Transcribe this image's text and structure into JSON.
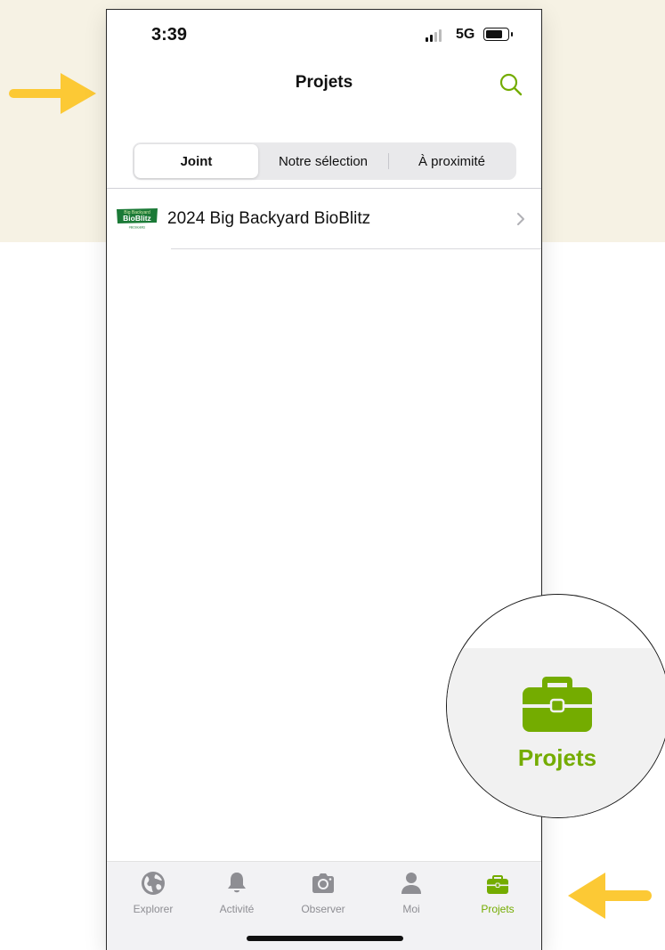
{
  "status_bar": {
    "time": "3:39",
    "network": "5G"
  },
  "header": {
    "title": "Projets",
    "search_icon": "search-icon"
  },
  "segments": [
    {
      "label": "Joint",
      "selected": true
    },
    {
      "label": "Notre sélection",
      "selected": false
    },
    {
      "label": "À proximité",
      "selected": false
    }
  ],
  "projects": [
    {
      "name": "2024 Big Backyard BioBlitz",
      "logo_top": "Big Backyard",
      "logo_main": "BioBlitz",
      "logo_tag": "#BCBioBlitz"
    }
  ],
  "tabs": [
    {
      "label": "Explorer",
      "icon": "globe-icon",
      "active": false
    },
    {
      "label": "Activité",
      "icon": "bell-icon",
      "active": false
    },
    {
      "label": "Observer",
      "icon": "camera-icon",
      "active": false
    },
    {
      "label": "Moi",
      "icon": "person-icon",
      "active": false
    },
    {
      "label": "Projets",
      "icon": "briefcase-icon",
      "active": true
    }
  ],
  "callout": {
    "label": "Projets",
    "icon": "briefcase-icon"
  },
  "colors": {
    "accent": "#74ac00",
    "arrow": "#fcc935",
    "background_band": "#f6f2e4",
    "logo_green": "#1b7a37"
  }
}
